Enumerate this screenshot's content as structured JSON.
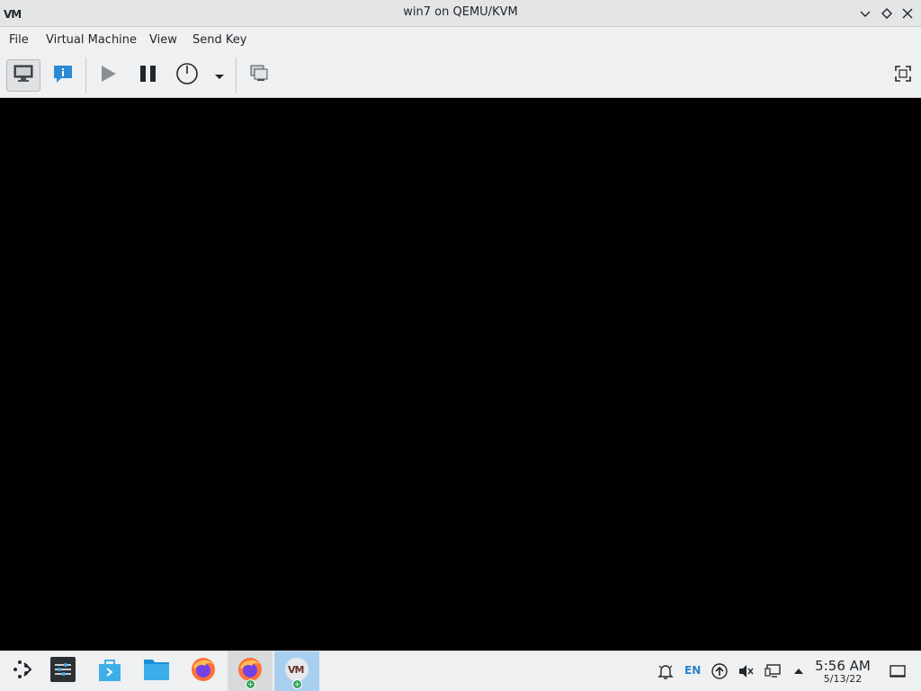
{
  "window": {
    "title": "win7 on QEMU/KVM",
    "icon": "vm-logo-icon",
    "controls": [
      "minimize-icon",
      "maximize-icon",
      "close-icon"
    ]
  },
  "menubar": {
    "items": [
      "File",
      "Virtual Machine",
      "View",
      "Send Key"
    ]
  },
  "toolbar": {
    "buttons": [
      {
        "name": "show-console",
        "icon": "monitor-icon",
        "active": true
      },
      {
        "name": "show-details",
        "icon": "info-icon",
        "active": false
      },
      {
        "name": "run",
        "icon": "play-icon",
        "active": false
      },
      {
        "name": "pause",
        "icon": "pause-icon",
        "active": false
      },
      {
        "name": "shutdown",
        "icon": "power-icon",
        "active": false
      },
      {
        "name": "shutdown-menu",
        "icon": "dropdown-arrow-icon",
        "active": false
      },
      {
        "name": "snapshots",
        "icon": "snapshots-icon",
        "active": false
      },
      {
        "name": "fullscreen",
        "icon": "fullscreen-icon",
        "active": false
      }
    ]
  },
  "console": {
    "background": "#000000"
  },
  "taskbar": {
    "launchers": [
      {
        "name": "application-launcher",
        "icon": "kde-launcher-icon"
      },
      {
        "name": "system-settings",
        "icon": "settings-icon"
      },
      {
        "name": "discover",
        "icon": "store-icon"
      },
      {
        "name": "dolphin",
        "icon": "folder-icon"
      },
      {
        "name": "firefox",
        "icon": "firefox-icon"
      },
      {
        "name": "firefox-running",
        "icon": "firefox-icon"
      },
      {
        "name": "virt-manager-running",
        "icon": "vm-logo-icon"
      }
    ],
    "tray": {
      "language": "EN",
      "icons": [
        "notifications-icon",
        "updates-icon",
        "volume-muted-icon",
        "network-icon",
        "expand-tray-icon"
      ],
      "clock_time": "5:56 AM",
      "clock_date": "5/13/22",
      "show_desktop_icon": "show-desktop-icon"
    }
  },
  "colors": {
    "chrome": "#eff0f1",
    "titlebar": "#e3e5e7",
    "accent": "#3daee9",
    "active_task": "#a9cff0"
  }
}
